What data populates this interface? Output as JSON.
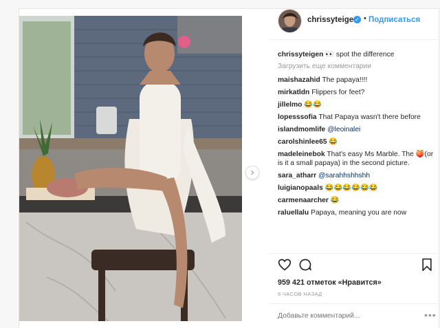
{
  "post": {
    "username": "chrissyteigen",
    "verified_icon": "verified-badge-icon",
    "dot": "•",
    "follow_label": "Подписаться",
    "caption_user": "chrissyteigen",
    "caption_text": " 👀 spot the difference",
    "load_more": "Загрузить еще комментарии",
    "comments": [
      {
        "user": "maishazahid",
        "text": " The papaya!!!!"
      },
      {
        "user": "mirkatldn",
        "text": " Flippers for feet?"
      },
      {
        "user": "jillelmo",
        "text": " 😂😂"
      },
      {
        "user": "lopesssofia",
        "text": " That Papaya wasn't there before"
      },
      {
        "user": "islandmomlife",
        "text": " ",
        "mention": "@leoinalei"
      },
      {
        "user": "carolshinlee65",
        "text": " 😂"
      },
      {
        "user": "madeleinebok",
        "text": " That's easy Ms Marble. The 🍑(or is it a small papaya) in the second picture."
      },
      {
        "user": "sara_atharr",
        "text": " ",
        "mention": "@sarahhshhshh"
      },
      {
        "user": "luigianopaals",
        "text": " 😂😂😂😂😂😂"
      },
      {
        "user": "carmenaarcher",
        "text": " 😂"
      },
      {
        "user": "raluellalu",
        "text": " Papaya, meaning you are now"
      }
    ],
    "likes": "959 421 отметок «Нравится»",
    "timestamp": "8 ЧАСОВ НАЗАД",
    "add_comment_placeholder": "Добавьте комментарий...",
    "more_options": "•••",
    "icons": {
      "like": "heart-icon",
      "comment": "comment-icon",
      "save": "bookmark-icon",
      "next": "chevron-right-icon"
    }
  }
}
